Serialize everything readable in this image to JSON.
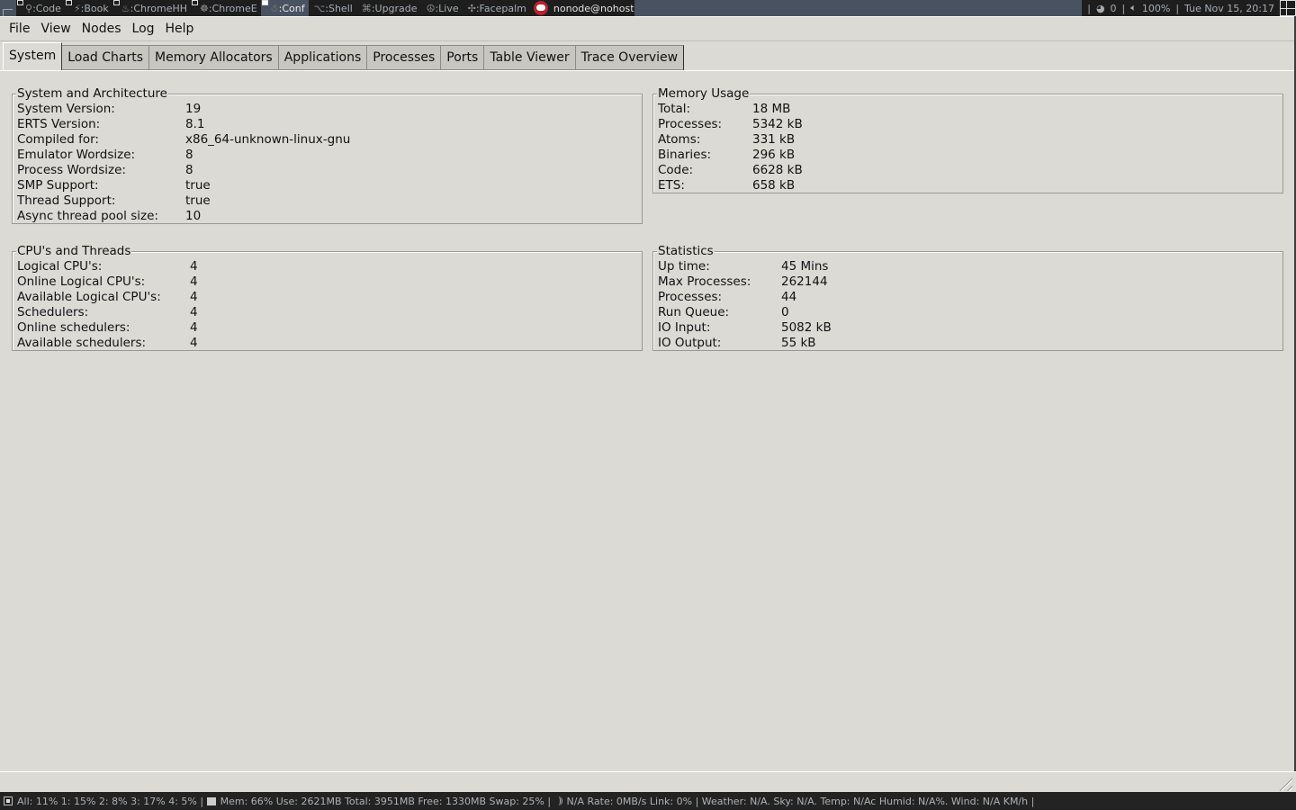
{
  "wm_bar": {
    "workspaces": [
      {
        "glyph": "⚲",
        "label": ":Code",
        "active": false
      },
      {
        "glyph": "⚡",
        "label": ":Book",
        "active": false
      },
      {
        "glyph": "♨",
        "label": ":ChromeHH",
        "active": false
      },
      {
        "glyph": "☸",
        "label": ":ChromeE",
        "active": false
      },
      {
        "glyph": "☃",
        "label": ":Conf",
        "active": true
      },
      {
        "glyph": "⌥",
        "label": ":Shell",
        "active": false
      },
      {
        "glyph": "⌘",
        "label": ":Upgrade",
        "active": false
      },
      {
        "glyph": "☮",
        "label": ":Live",
        "active": false
      },
      {
        "glyph": "✣",
        "label": ":Facepalm",
        "active": false
      }
    ],
    "window_title": "nonode@nohost",
    "right": {
      "sep1": "|",
      "updates": "0",
      "sep2": "|",
      "volume": "100%",
      "sep3": "|",
      "datetime": "Tue Nov 15, 20:17"
    }
  },
  "menubar": {
    "items": [
      "File",
      "View",
      "Nodes",
      "Log",
      "Help"
    ]
  },
  "tabs": [
    {
      "label": "System",
      "active": true
    },
    {
      "label": "Load Charts",
      "active": false
    },
    {
      "label": "Memory Allocators",
      "active": false
    },
    {
      "label": "Applications",
      "active": false
    },
    {
      "label": "Processes",
      "active": false
    },
    {
      "label": "Ports",
      "active": false
    },
    {
      "label": "Table Viewer",
      "active": false
    },
    {
      "label": "Trace Overview",
      "active": false
    }
  ],
  "panels": {
    "system": {
      "title": "System and Architecture",
      "rows": [
        {
          "k": "System Version:",
          "v": "19"
        },
        {
          "k": "ERTS Version:",
          "v": "8.1"
        },
        {
          "k": "Compiled for:",
          "v": "x86_64-unknown-linux-gnu"
        },
        {
          "k": "Emulator Wordsize:",
          "v": "8"
        },
        {
          "k": "Process Wordsize:",
          "v": "8"
        },
        {
          "k": "SMP Support:",
          "v": "true"
        },
        {
          "k": "Thread Support:",
          "v": "true"
        },
        {
          "k": "Async thread pool size:",
          "v": "10"
        }
      ]
    },
    "memory": {
      "title": "Memory Usage",
      "rows": [
        {
          "k": "Total:",
          "v": "18 MB"
        },
        {
          "k": "Processes:",
          "v": "5342 kB"
        },
        {
          "k": "Atoms:",
          "v": "331 kB"
        },
        {
          "k": "Binaries:",
          "v": "296 kB"
        },
        {
          "k": "Code:",
          "v": "6628 kB"
        },
        {
          "k": "ETS:",
          "v": "658 kB"
        }
      ]
    },
    "cpu": {
      "title": "CPU's and Threads",
      "rows": [
        {
          "k": "Logical CPU's:",
          "v": "4"
        },
        {
          "k": "Online Logical CPU's:",
          "v": "4"
        },
        {
          "k": "Available Logical CPU's:",
          "v": "4"
        },
        {
          "k": "Schedulers:",
          "v": "4"
        },
        {
          "k": "Online schedulers:",
          "v": "4"
        },
        {
          "k": "Available schedulers:",
          "v": "4"
        }
      ]
    },
    "statistics": {
      "title": "Statistics",
      "rows": [
        {
          "k": "Up time:",
          "v": "45 Mins"
        },
        {
          "k": "Max Processes:",
          "v": "262144"
        },
        {
          "k": "Processes:",
          "v": "44"
        },
        {
          "k": "Run Queue:",
          "v": "0"
        },
        {
          "k": "IO Input:",
          "v": "5082 kB"
        },
        {
          "k": "IO Output:",
          "v": "55 kB"
        }
      ]
    }
  },
  "sys_bar": {
    "cpu": "All: 11% 1: 15% 2: 8% 3: 17% 4: 5% | ",
    "mem": "Mem: 66% Use: 2621MB Total: 3951MB Free: 1330MB Swap: 25% | ",
    "net": "N/A Rate: 0MB/s Link: 0% | Weather: N/A. Sky: N/A. Temp: N/Ac Humid: N/A%. Wind: N/A KM/h |"
  }
}
